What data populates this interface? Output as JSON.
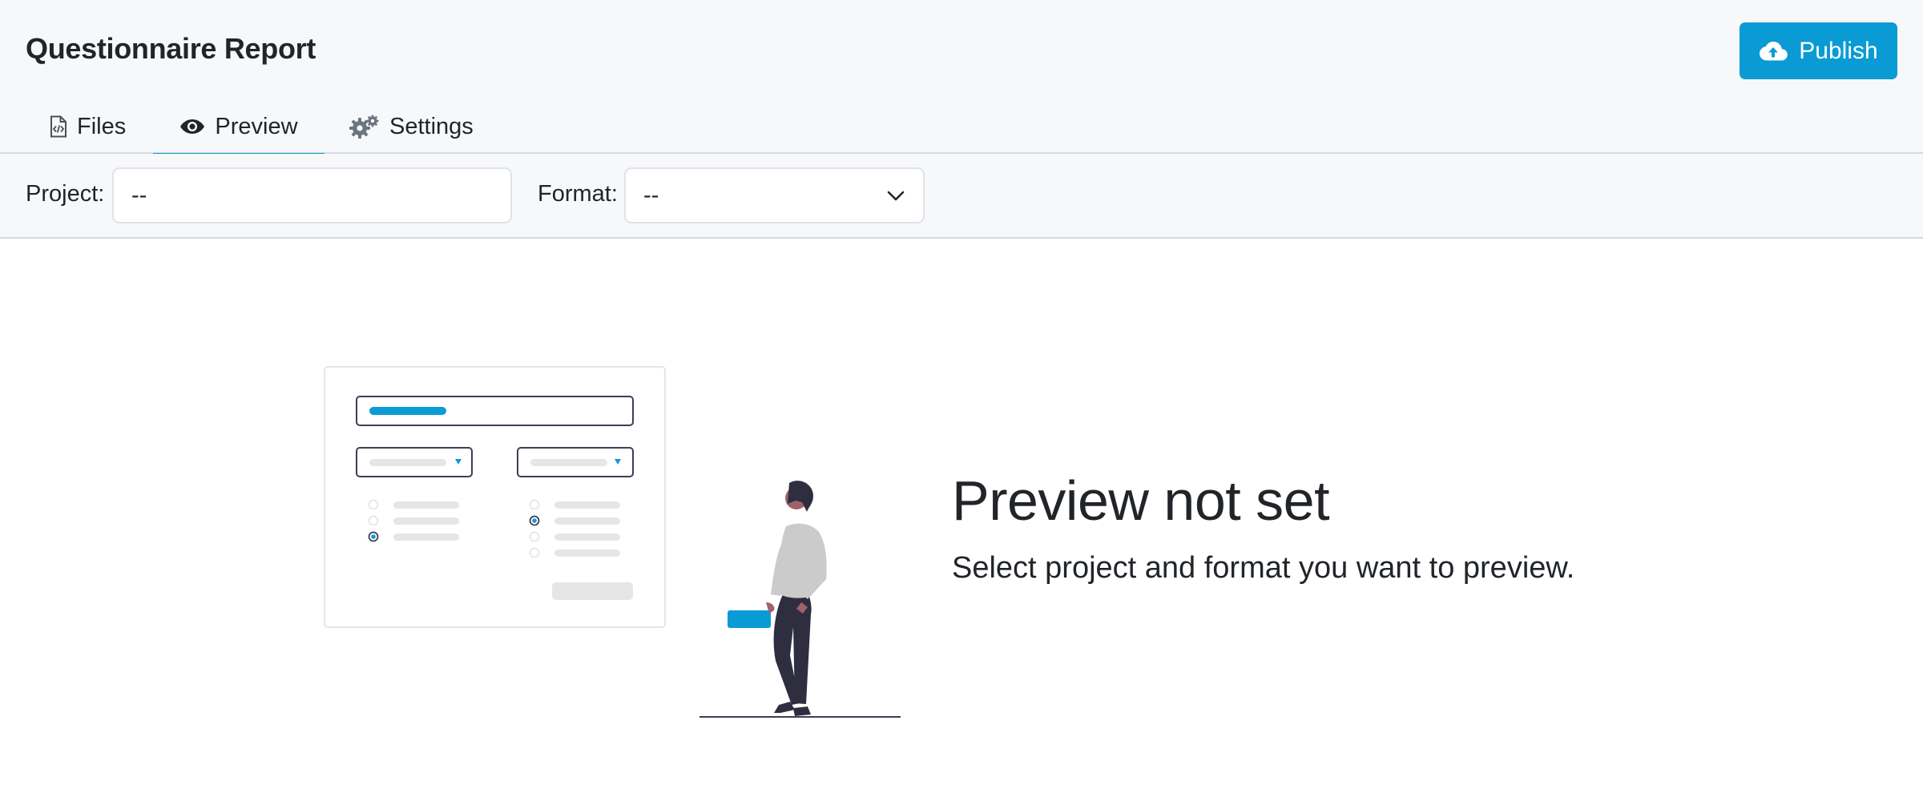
{
  "app": {
    "title": "Questionnaire Report",
    "publish_label": "Publish"
  },
  "tabs": [
    {
      "label": "Files",
      "icon": "file-code-icon",
      "active": false
    },
    {
      "label": "Preview",
      "icon": "eye-icon",
      "active": true
    },
    {
      "label": "Settings",
      "icon": "gears-icon",
      "active": false
    }
  ],
  "filters": {
    "project_label": "Project:",
    "project_value": "--",
    "format_label": "Format:",
    "format_value": "--"
  },
  "empty_state": {
    "title": "Preview not set",
    "message": "Select project and format you want to preview."
  },
  "colors": {
    "accent": "#0a9bd4",
    "header_bg": "#f7f8fa",
    "text": "#212529"
  }
}
